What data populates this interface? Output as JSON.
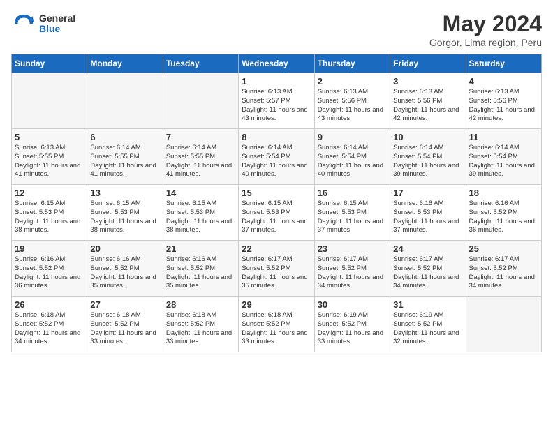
{
  "header": {
    "logo_line1": "General",
    "logo_line2": "Blue",
    "month_title": "May 2024",
    "location": "Gorgor, Lima region, Peru"
  },
  "days_header": [
    "Sunday",
    "Monday",
    "Tuesday",
    "Wednesday",
    "Thursday",
    "Friday",
    "Saturday"
  ],
  "weeks": [
    [
      {
        "day": "",
        "empty": true
      },
      {
        "day": "",
        "empty": true
      },
      {
        "day": "",
        "empty": true
      },
      {
        "day": "1",
        "sunrise": "6:13 AM",
        "sunset": "5:57 PM",
        "daylight": "11 hours and 43 minutes."
      },
      {
        "day": "2",
        "sunrise": "6:13 AM",
        "sunset": "5:56 PM",
        "daylight": "11 hours and 43 minutes."
      },
      {
        "day": "3",
        "sunrise": "6:13 AM",
        "sunset": "5:56 PM",
        "daylight": "11 hours and 42 minutes."
      },
      {
        "day": "4",
        "sunrise": "6:13 AM",
        "sunset": "5:56 PM",
        "daylight": "11 hours and 42 minutes."
      }
    ],
    [
      {
        "day": "5",
        "sunrise": "6:13 AM",
        "sunset": "5:55 PM",
        "daylight": "11 hours and 41 minutes."
      },
      {
        "day": "6",
        "sunrise": "6:14 AM",
        "sunset": "5:55 PM",
        "daylight": "11 hours and 41 minutes."
      },
      {
        "day": "7",
        "sunrise": "6:14 AM",
        "sunset": "5:55 PM",
        "daylight": "11 hours and 41 minutes."
      },
      {
        "day": "8",
        "sunrise": "6:14 AM",
        "sunset": "5:54 PM",
        "daylight": "11 hours and 40 minutes."
      },
      {
        "day": "9",
        "sunrise": "6:14 AM",
        "sunset": "5:54 PM",
        "daylight": "11 hours and 40 minutes."
      },
      {
        "day": "10",
        "sunrise": "6:14 AM",
        "sunset": "5:54 PM",
        "daylight": "11 hours and 39 minutes."
      },
      {
        "day": "11",
        "sunrise": "6:14 AM",
        "sunset": "5:54 PM",
        "daylight": "11 hours and 39 minutes."
      }
    ],
    [
      {
        "day": "12",
        "sunrise": "6:15 AM",
        "sunset": "5:53 PM",
        "daylight": "11 hours and 38 minutes."
      },
      {
        "day": "13",
        "sunrise": "6:15 AM",
        "sunset": "5:53 PM",
        "daylight": "11 hours and 38 minutes."
      },
      {
        "day": "14",
        "sunrise": "6:15 AM",
        "sunset": "5:53 PM",
        "daylight": "11 hours and 38 minutes."
      },
      {
        "day": "15",
        "sunrise": "6:15 AM",
        "sunset": "5:53 PM",
        "daylight": "11 hours and 37 minutes."
      },
      {
        "day": "16",
        "sunrise": "6:15 AM",
        "sunset": "5:53 PM",
        "daylight": "11 hours and 37 minutes."
      },
      {
        "day": "17",
        "sunrise": "6:16 AM",
        "sunset": "5:53 PM",
        "daylight": "11 hours and 37 minutes."
      },
      {
        "day": "18",
        "sunrise": "6:16 AM",
        "sunset": "5:52 PM",
        "daylight": "11 hours and 36 minutes."
      }
    ],
    [
      {
        "day": "19",
        "sunrise": "6:16 AM",
        "sunset": "5:52 PM",
        "daylight": "11 hours and 36 minutes."
      },
      {
        "day": "20",
        "sunrise": "6:16 AM",
        "sunset": "5:52 PM",
        "daylight": "11 hours and 35 minutes."
      },
      {
        "day": "21",
        "sunrise": "6:16 AM",
        "sunset": "5:52 PM",
        "daylight": "11 hours and 35 minutes."
      },
      {
        "day": "22",
        "sunrise": "6:17 AM",
        "sunset": "5:52 PM",
        "daylight": "11 hours and 35 minutes."
      },
      {
        "day": "23",
        "sunrise": "6:17 AM",
        "sunset": "5:52 PM",
        "daylight": "11 hours and 34 minutes."
      },
      {
        "day": "24",
        "sunrise": "6:17 AM",
        "sunset": "5:52 PM",
        "daylight": "11 hours and 34 minutes."
      },
      {
        "day": "25",
        "sunrise": "6:17 AM",
        "sunset": "5:52 PM",
        "daylight": "11 hours and 34 minutes."
      }
    ],
    [
      {
        "day": "26",
        "sunrise": "6:18 AM",
        "sunset": "5:52 PM",
        "daylight": "11 hours and 34 minutes."
      },
      {
        "day": "27",
        "sunrise": "6:18 AM",
        "sunset": "5:52 PM",
        "daylight": "11 hours and 33 minutes."
      },
      {
        "day": "28",
        "sunrise": "6:18 AM",
        "sunset": "5:52 PM",
        "daylight": "11 hours and 33 minutes."
      },
      {
        "day": "29",
        "sunrise": "6:18 AM",
        "sunset": "5:52 PM",
        "daylight": "11 hours and 33 minutes."
      },
      {
        "day": "30",
        "sunrise": "6:19 AM",
        "sunset": "5:52 PM",
        "daylight": "11 hours and 33 minutes."
      },
      {
        "day": "31",
        "sunrise": "6:19 AM",
        "sunset": "5:52 PM",
        "daylight": "11 hours and 32 minutes."
      },
      {
        "day": "",
        "empty": true
      }
    ]
  ],
  "row_shading": [
    "white",
    "gray",
    "white",
    "gray",
    "white"
  ]
}
